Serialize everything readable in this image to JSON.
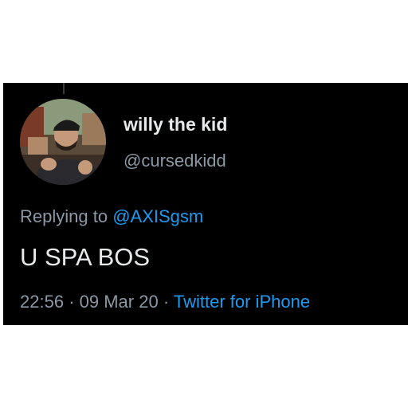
{
  "tweet": {
    "display_name": "willy the kid",
    "handle": "@cursedkidd",
    "avatar_icon": "profile-photo",
    "reply_prefix": "Replying to",
    "reply_to": "@AXISgsm",
    "text": "U SPA BOS",
    "time": "22:56",
    "separator": "·",
    "date": "09 Mar 20",
    "source": "Twitter for iPhone"
  },
  "colors": {
    "background": "#000000",
    "primary_text": "#e7e9ea",
    "secondary_text": "#8b98a5",
    "link": "#1d9bf0"
  }
}
